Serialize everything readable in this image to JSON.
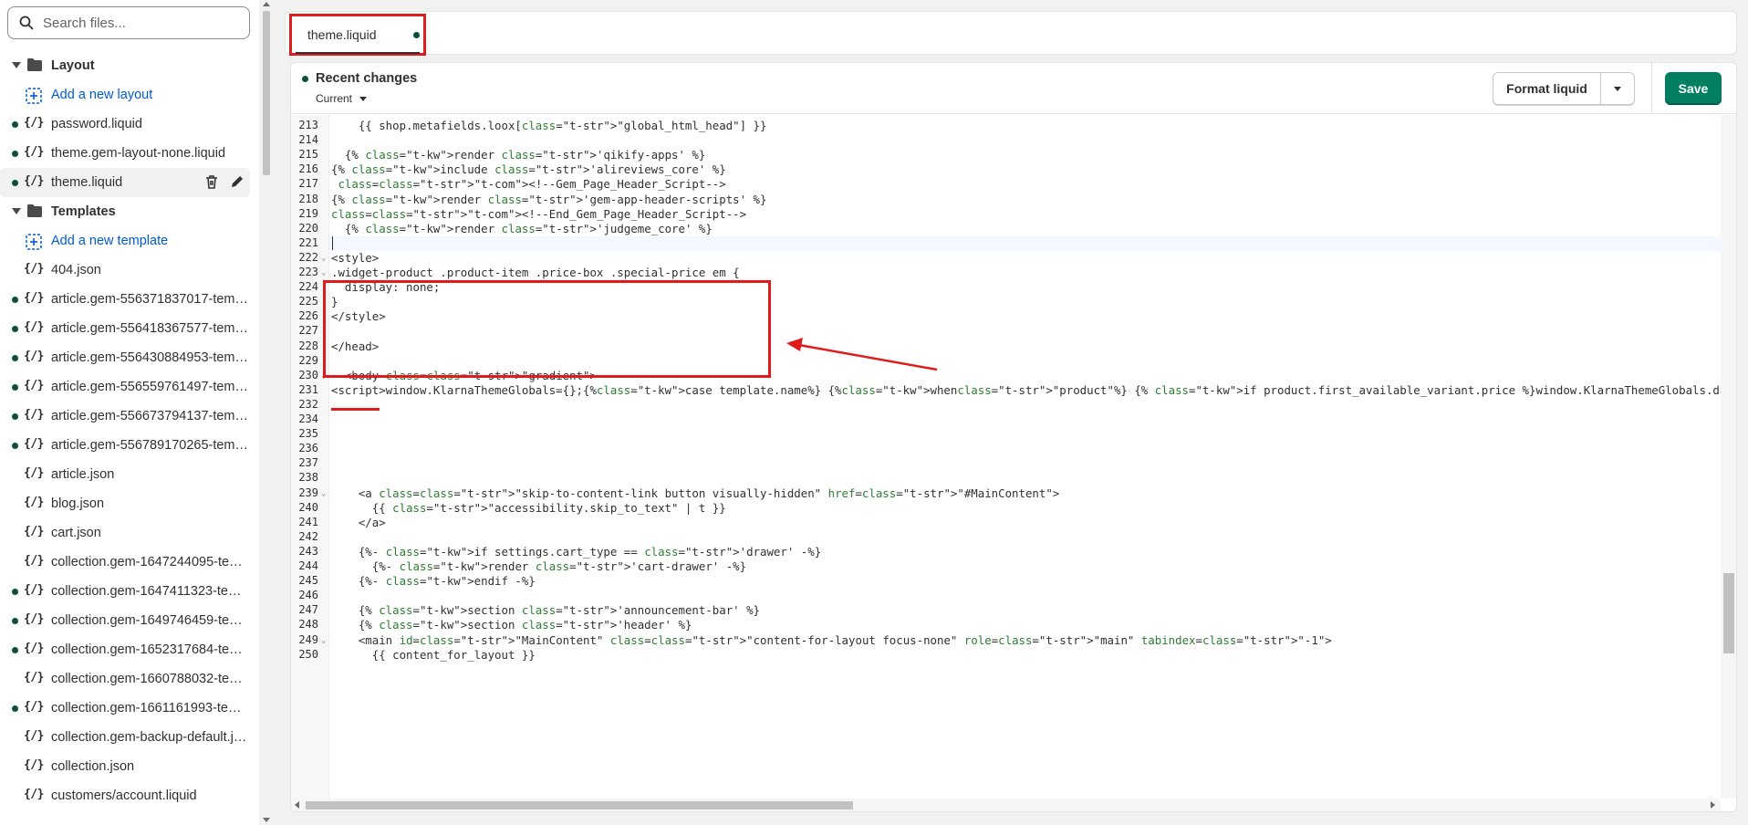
{
  "sidebar": {
    "search_placeholder": "Search files...",
    "items": [
      {
        "type": "folder",
        "label": "Layout"
      },
      {
        "type": "add",
        "label": "Add a new layout"
      },
      {
        "type": "file",
        "label": "password.liquid",
        "dot": true
      },
      {
        "type": "file",
        "label": "theme.gem-layout-none.liquid",
        "dot": true
      },
      {
        "type": "file",
        "label": "theme.liquid",
        "dot": true,
        "active": true
      },
      {
        "type": "folder",
        "label": "Templates"
      },
      {
        "type": "add",
        "label": "Add a new template"
      },
      {
        "type": "file",
        "label": "404.json",
        "dot": false
      },
      {
        "type": "file",
        "label": "article.gem-556371837017-templ...",
        "dot": true
      },
      {
        "type": "file",
        "label": "article.gem-556418367577-templ...",
        "dot": true
      },
      {
        "type": "file",
        "label": "article.gem-556430884953-templ...",
        "dot": true
      },
      {
        "type": "file",
        "label": "article.gem-556559761497-templ...",
        "dot": true
      },
      {
        "type": "file",
        "label": "article.gem-556673794137-templ...",
        "dot": true
      },
      {
        "type": "file",
        "label": "article.gem-556789170265-templ...",
        "dot": true
      },
      {
        "type": "file",
        "label": "article.json",
        "dot": false
      },
      {
        "type": "file",
        "label": "blog.json",
        "dot": false
      },
      {
        "type": "file",
        "label": "cart.json",
        "dot": false
      },
      {
        "type": "file",
        "label": "collection.gem-1647244095-tem...",
        "dot": false
      },
      {
        "type": "file",
        "label": "collection.gem-1647411323-tem...",
        "dot": true
      },
      {
        "type": "file",
        "label": "collection.gem-1649746459-tem...",
        "dot": true
      },
      {
        "type": "file",
        "label": "collection.gem-1652317684-tem...",
        "dot": true
      },
      {
        "type": "file",
        "label": "collection.gem-1660788032-tem...",
        "dot": false
      },
      {
        "type": "file",
        "label": "collection.gem-1661161993-tem...",
        "dot": true
      },
      {
        "type": "file",
        "label": "collection.gem-backup-default.json",
        "dot": false
      },
      {
        "type": "file",
        "label": "collection.json",
        "dot": false
      },
      {
        "type": "file",
        "label": "customers/account.liquid",
        "dot": false
      }
    ],
    "file_icon": "{/}"
  },
  "tab": {
    "title": "theme.liquid",
    "unsaved": true
  },
  "editor": {
    "recent_changes_label": "Recent changes",
    "version_select": "Current",
    "format_button": "Format liquid",
    "save_button": "Save",
    "lines": [
      {
        "n": "213",
        "text": "    {{ shop.metafields.loox[\"global_html_head\"] }}"
      },
      {
        "n": "214",
        "text": ""
      },
      {
        "n": "215",
        "text": "  {% render 'qikify-apps' %}"
      },
      {
        "n": "216",
        "text": "{% include 'alireviews_core' %}"
      },
      {
        "n": "217",
        "text": " <!--Gem_Page_Header_Script-->"
      },
      {
        "n": "218",
        "text": "{% render 'gem-app-header-scripts' %}"
      },
      {
        "n": "219",
        "text": "<!--End_Gem_Page_Header_Script-->"
      },
      {
        "n": "220",
        "text": "  {% render 'judgeme_core' %}"
      },
      {
        "n": "221",
        "text": ""
      },
      {
        "n": "222",
        "text": "<style>",
        "fold": true
      },
      {
        "n": "223",
        "text": ".widget-product .product-item .price-box .special-price em {",
        "fold": true
      },
      {
        "n": "224",
        "text": "  display: none;"
      },
      {
        "n": "225",
        "text": "}"
      },
      {
        "n": "226",
        "text": "</style>"
      },
      {
        "n": "227",
        "text": ""
      },
      {
        "n": "228",
        "text": "</head>"
      },
      {
        "n": "229",
        "text": ""
      },
      {
        "n": "230",
        "text": "  <body class=\"gradient\">",
        "fold": true
      },
      {
        "n": "231",
        "text": "<script>window.KlarnaThemeGlobals={};{%case template.name%} {%when\"product\"%} {% if product.first_available_variant.price %}window.KlarnaThemeGlobals.data_purchase_amount = {{ product.first_availabl"
      },
      {
        "n": "232",
        "text": ""
      },
      {
        "n": "234",
        "text": ""
      },
      {
        "n": "235",
        "text": ""
      },
      {
        "n": "236",
        "text": ""
      },
      {
        "n": "237",
        "text": ""
      },
      {
        "n": "238",
        "text": ""
      },
      {
        "n": "239",
        "text": "    <a class=\"skip-to-content-link button visually-hidden\" href=\"#MainContent\">",
        "fold": true
      },
      {
        "n": "240",
        "text": "      {{ \"accessibility.skip_to_text\" | t }}"
      },
      {
        "n": "241",
        "text": "    </a>"
      },
      {
        "n": "242",
        "text": ""
      },
      {
        "n": "243",
        "text": "    {%- if settings.cart_type == 'drawer' -%}"
      },
      {
        "n": "244",
        "text": "      {%- render 'cart-drawer' -%}"
      },
      {
        "n": "245",
        "text": "    {%- endif -%}"
      },
      {
        "n": "246",
        "text": ""
      },
      {
        "n": "247",
        "text": "    {% section 'announcement-bar' %}"
      },
      {
        "n": "248",
        "text": "    {% section 'header' %}"
      },
      {
        "n": "249",
        "text": "    <main id=\"MainContent\" class=\"content-for-layout focus-none\" role=\"main\" tabindex=\"-1\">",
        "fold": true
      },
      {
        "n": "250",
        "text": "      {{ content_for_layout }}"
      }
    ]
  },
  "colors": {
    "accent_green": "#008060",
    "dot_green": "#0c5132",
    "annotation_red": "#e01b1b",
    "link_blue": "#005bd3"
  }
}
